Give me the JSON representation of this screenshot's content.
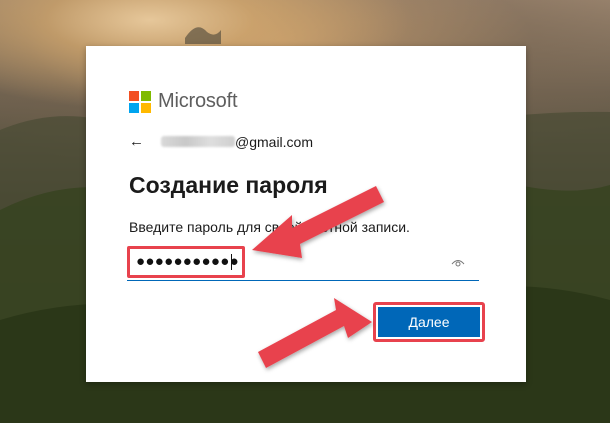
{
  "brand": {
    "name": "Microsoft",
    "colors": [
      "#f25022",
      "#7fba00",
      "#00a4ef",
      "#ffb900"
    ]
  },
  "identity": {
    "back_icon": "←",
    "email_domain": "@gmail.com"
  },
  "title": "Создание пароля",
  "description": "Введите пароль для своей учетной записи.",
  "password": {
    "masked_value": "●●●●●●●●●●●",
    "icon": "eye-icon"
  },
  "next_button": {
    "label": "Далее"
  },
  "colors": {
    "accent": "#0067b8",
    "highlight": "#e8424d"
  }
}
